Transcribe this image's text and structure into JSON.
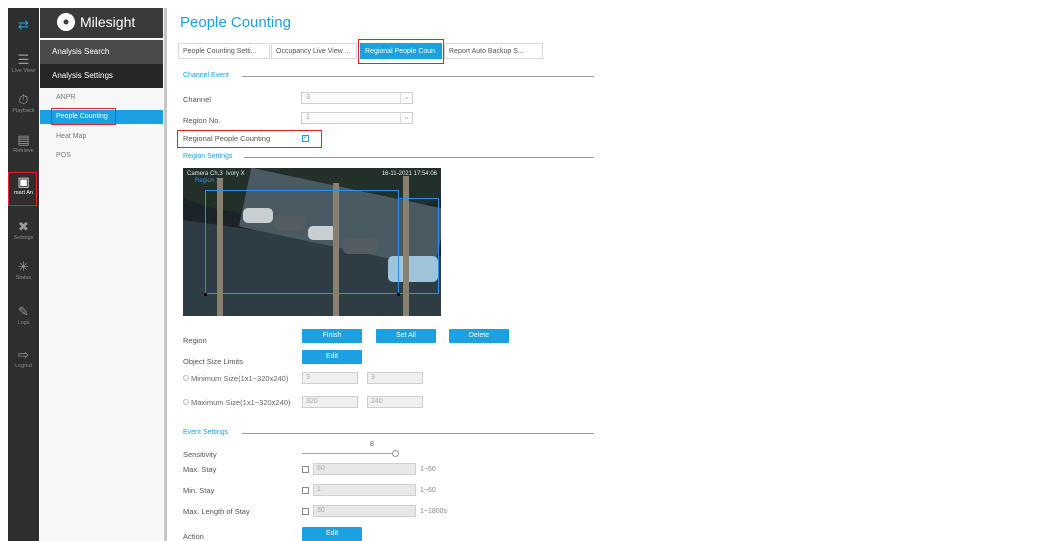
{
  "rail": {
    "items": [
      {
        "label": "",
        "icon": "transfer-icon"
      },
      {
        "label": "Live View",
        "icon": "live-view-icon"
      },
      {
        "label": "Playback",
        "icon": "playback-icon"
      },
      {
        "label": "Retrieve",
        "icon": "retrieve-icon"
      },
      {
        "label": "mart An",
        "icon": "smart-analysis-icon"
      },
      {
        "label": "Settings",
        "icon": "settings-icon"
      },
      {
        "label": "Status",
        "icon": "status-icon"
      },
      {
        "label": "Logs",
        "icon": "logs-icon"
      },
      {
        "label": "Logout",
        "icon": "logout-icon"
      }
    ]
  },
  "brand": {
    "name": "Milesight"
  },
  "menu": {
    "analysis_search": "Analysis Search",
    "analysis_settings": "Analysis Settings",
    "items": [
      "ANPR",
      "People Counting",
      "Heat Map",
      "POS"
    ]
  },
  "page": {
    "title": "People Counting"
  },
  "tabs": [
    "People Counting Setti...",
    "Occupancy Live View ...",
    "Regional People Coun",
    "Report Auto Backup S..."
  ],
  "channel_event": {
    "section": "Channel Event",
    "channel_label": "Channel",
    "channel_value": "3",
    "region_label": "Region No.",
    "region_value": "1",
    "rpc_label": "Regional People Counting"
  },
  "region_settings": {
    "section": "Region Settings",
    "video_stamp": "Camera Ch.3  Ivory X",
    "video_region_label": "Region 1",
    "video_date": "16-11-2021 17:54:06",
    "region_label": "Region",
    "finish_button": "Finish",
    "set_all_button": "Set All",
    "delete_button": "Delete",
    "object_size_label": "Object Size Limits",
    "edit_button": "Edit",
    "min_label": "Minimum Size(1x1~320x240)",
    "min_w": "3",
    "min_h": "3",
    "max_label": "Maximum Size(1x1~320x240)",
    "max_w": "320",
    "max_h": "240",
    "times": "x"
  },
  "event_settings": {
    "section": "Event Settings",
    "sensitivity_label": "Sensitivity",
    "sensitivity_value": "8",
    "max_stay_label": "Max. Stay",
    "max_stay_value": "60",
    "max_stay_range": "1~60",
    "min_stay_label": "Min. Stay",
    "min_stay_value": "1",
    "min_stay_range": "1~60",
    "max_length_label": "Max. Length of Stay",
    "max_length_value": "30",
    "max_length_range": "1~1800s",
    "action_label": "Action",
    "action_button": "Edit"
  },
  "colors": {
    "accent": "#1ba1e2",
    "highlight": "#e0242c",
    "rail": "#2e2e2e"
  }
}
